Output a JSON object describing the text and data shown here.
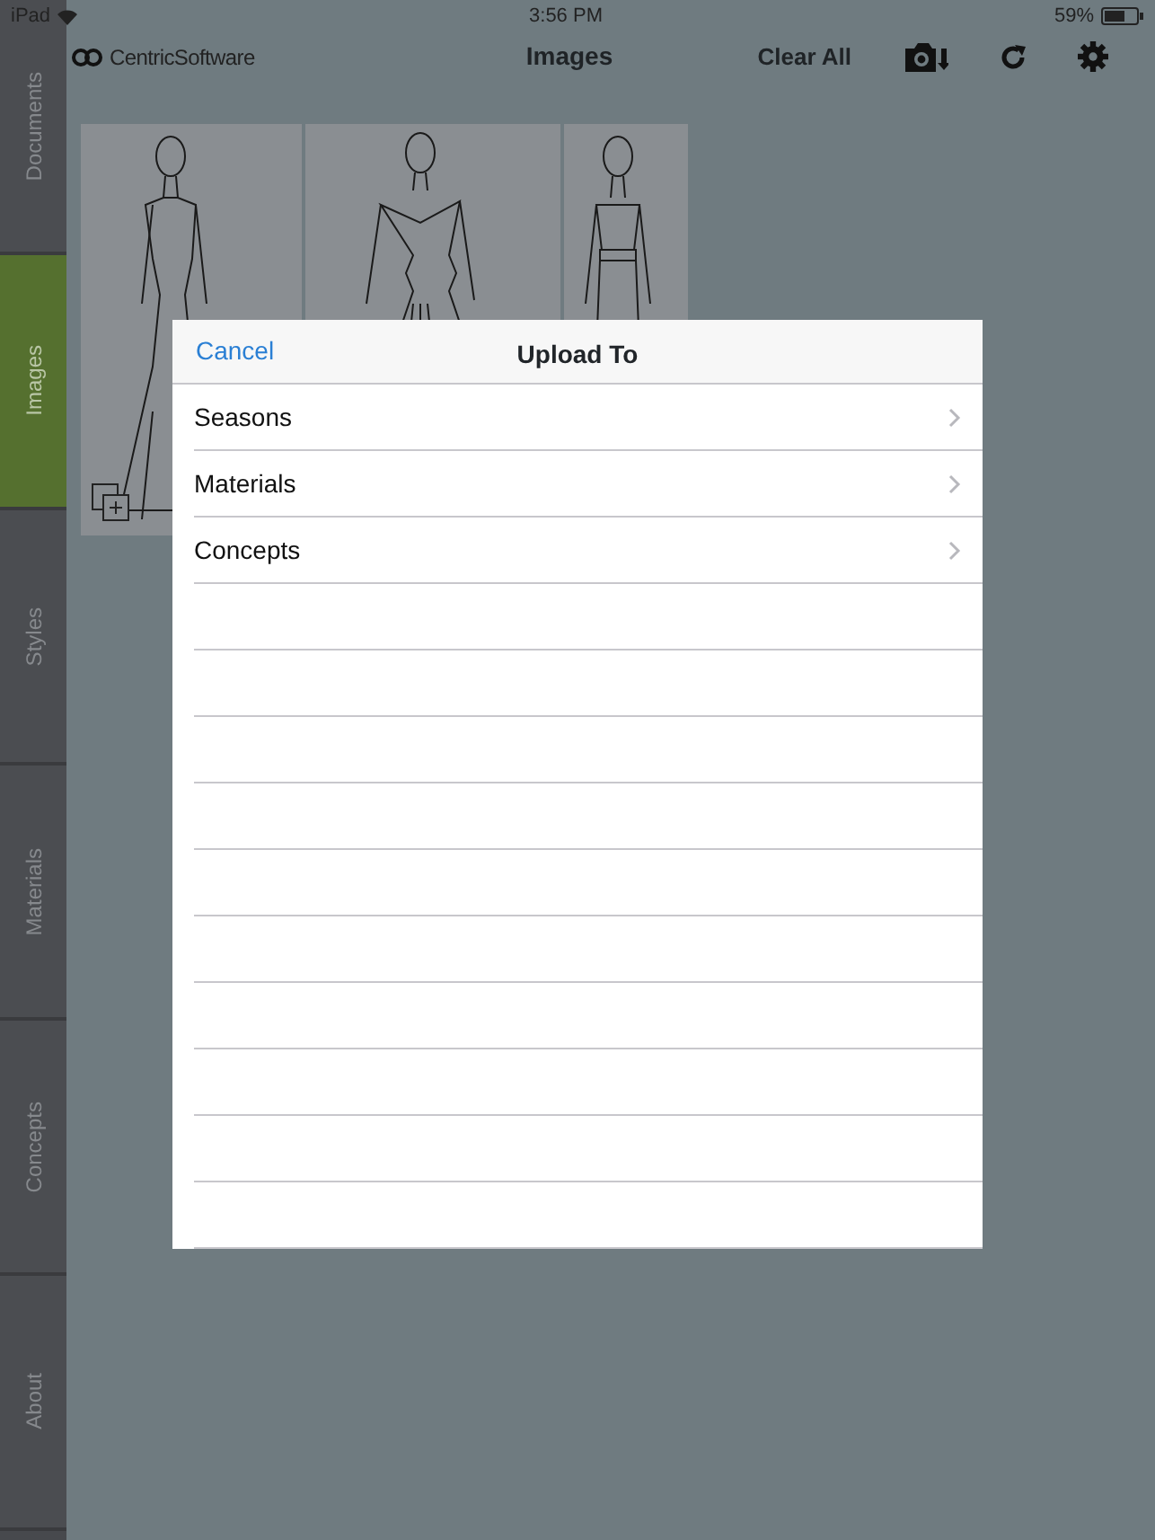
{
  "status_bar": {
    "device": "iPad",
    "time": "3:56 PM",
    "battery": "59%"
  },
  "toolbar": {
    "logo": "CentricSoftware",
    "title": "Images",
    "clear_all": "Clear All"
  },
  "sidebar": {
    "tabs": [
      {
        "label": "Documents",
        "selected": false
      },
      {
        "label": "Images",
        "selected": true
      },
      {
        "label": "Styles",
        "selected": false
      },
      {
        "label": "Materials",
        "selected": false
      },
      {
        "label": "Concepts",
        "selected": false
      },
      {
        "label": "About",
        "selected": false
      }
    ]
  },
  "images": [
    {
      "kind": "mermaid"
    },
    {
      "kind": "gown"
    },
    {
      "kind": "belted"
    }
  ],
  "upload_dialog": {
    "cancel": "Cancel",
    "title": "Upload To",
    "rows": [
      {
        "label": "Seasons"
      },
      {
        "label": "Materials"
      },
      {
        "label": "Concepts"
      }
    ]
  }
}
